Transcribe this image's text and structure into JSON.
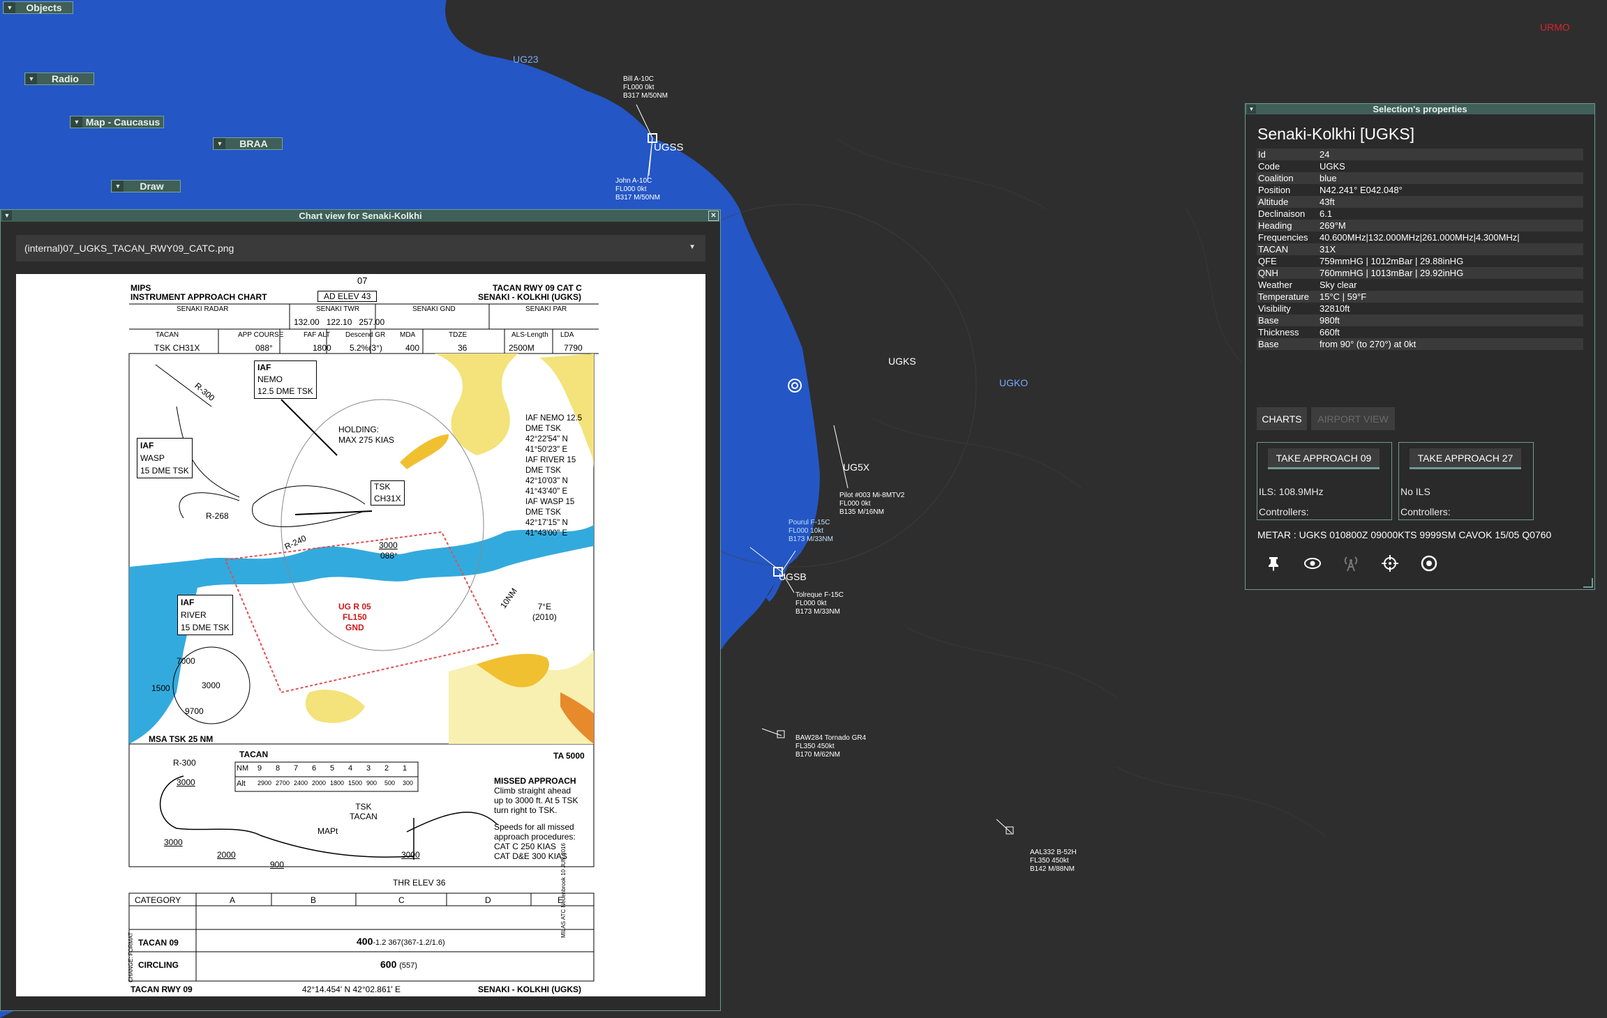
{
  "menus": {
    "objects": "Objects",
    "radio": "Radio",
    "map": "Map - Caucasus",
    "braa": "BRAA",
    "draw": "Draw"
  },
  "map_labels": {
    "ug23": "UG23",
    "urmo": "URMO",
    "ugss": "UGSS",
    "ugks": "UGKS",
    "ugko": "UGKO",
    "ug5x": "UG5X",
    "ugsb": "UGSB"
  },
  "aircraft": [
    {
      "l1": "Bill A-10C",
      "l2": "FL000 0kt",
      "l3": "B317 M/50NM"
    },
    {
      "l1": "John A-10C",
      "l2": "FL000 0kt",
      "l3": "B317 M/50NM"
    },
    {
      "l1": "Pilot #003 Mi-8MTV2",
      "l2": "FL000 0kt",
      "l3": "B135 M/16NM"
    },
    {
      "l1": "Pourul F-15C",
      "l2": "FL000 10kt",
      "l3": "B173 M/33NM"
    },
    {
      "l1": "Tolreque F-15C",
      "l2": "FL000 0kt",
      "l3": "B173 M/33NM"
    },
    {
      "l1": "BAW284 Tornado GR4",
      "l2": "FL350 450kt",
      "l3": "B170 M/62NM"
    },
    {
      "l1": "AAL332 B-52H",
      "l2": "FL350 450kt",
      "l3": "B142 M/88NM"
    }
  ],
  "chart_window": {
    "title": "Chart view for Senaki-Kolkhi",
    "selected_file": "(internal)07_UGKS_TACAN_RWY09_CATC.png"
  },
  "plate": {
    "page_no": "07",
    "org": "MIPS",
    "type": "INSTRUMENT APPROACH CHART",
    "ad_elev": "AD ELEV 43",
    "proc": "TACAN RWY 09 CAT C",
    "airport": "SENAKI - KOLKHI (UGKS)",
    "freq_labels": [
      "SENAKI RADAR",
      "SENAKI TWR",
      "SENAKI GND",
      "SENAKI PAR"
    ],
    "twr_freqs": "132.00   122.10   257.00",
    "data_headers": [
      "TACAN",
      "APP COURSE",
      "FAF ALT",
      "Descend GR",
      "MDA",
      "TDZE",
      "ALS-Length",
      "LDA"
    ],
    "data_values": [
      "TSK CH31X",
      "088°",
      "1800",
      "5.2%(3°)",
      "400",
      "36",
      "2500M",
      "7790"
    ],
    "holding": "HOLDING:",
    "holding2": "MAX 275 KIAS",
    "iaf_nemo": [
      "IAF",
      "NEMO",
      "12.5 DME TSK"
    ],
    "iaf_wasp": [
      "IAF",
      "WASP",
      "15 DME TSK"
    ],
    "iaf_river": [
      "IAF",
      "RIVER",
      "15 DME TSK"
    ],
    "fix_notes": [
      "IAF NEMO 12.5",
      "DME TSK",
      "42°22'54\" N",
      "41°50'23\" E",
      "IAF RIVER 15",
      "DME TSK",
      "42°10'03\" N",
      "41°43'40\" E",
      "IAF WASP 15",
      "DME TSK",
      "42°17'15\" N",
      "41°43'00\" E"
    ],
    "tsk": "TSK",
    "ch31x": "CH31X",
    "restricted": [
      "UG R 05",
      "FL150",
      "GND"
    ],
    "msa": "MSA TSK 25 NM",
    "msa_vals": [
      "7000",
      "1500",
      "3000",
      "9700"
    ],
    "r300": "R-300",
    "r268": "R-268",
    "r240": "R-240",
    "alt_3000": "3000",
    "alt_088": "088°",
    "var": "7°E",
    "var_year": "(2010)",
    "nm10": "10NM",
    "ta": "TA 5000",
    "tacan_hdr": "TACAN",
    "nm_row": [
      "NM",
      "9",
      "8",
      "7",
      "6",
      "5",
      "4",
      "3",
      "2",
      "1"
    ],
    "alt_row": [
      "Alt",
      "2900",
      "2700",
      "2400",
      "2000",
      "1800",
      "1500",
      "900",
      "500",
      "300"
    ],
    "missed_title": "MISSED APPROACH",
    "missed_lines": [
      "Climb straight ahead",
      "up to 3000 ft. At 5 TSK",
      "turn right to TSK."
    ],
    "speed_lines": [
      "Speeds for all missed",
      "approach procedures:",
      "CAT C 250 KIAS",
      "CAT D&E 300 KIAS"
    ],
    "mapt": "MAPt",
    "thr_elev": "THR ELEV 36",
    "profile_alts": [
      "3000",
      "3000",
      "2000",
      "900",
      "3000"
    ],
    "category": "CATEGORY",
    "cats": [
      "A",
      "B",
      "C",
      "D",
      "E"
    ],
    "tacan09": "TACAN 09",
    "tacan09_val": "400",
    "tacan09_sub": "-1.2 367(367-1.2/1.6)",
    "circling": "CIRCLING",
    "circling_val": "600",
    "circling_sub": "(557)",
    "footer_left": "TACAN RWY 09",
    "footer_mid": "42°14.454' N  42°02.861' E",
    "footer_right": "SENAKI - KOLKHI (UGKS)",
    "side_note": "MILAS ATC Neuenbrook 10 JUN 2016",
    "side_left": "CHANGE: FORMAT"
  },
  "selection": {
    "title": "Selection's properties",
    "name": "Senaki-Kolkhi [UGKS]",
    "props": [
      {
        "k": "Id",
        "v": "24"
      },
      {
        "k": "Code",
        "v": "UGKS"
      },
      {
        "k": "Coalition",
        "v": "blue"
      },
      {
        "k": "Position",
        "v": "N42.241° E042.048°"
      },
      {
        "k": "Altitude",
        "v": "43ft"
      },
      {
        "k": "Declinaison",
        "v": "6.1"
      },
      {
        "k": "Heading",
        "v": "269°M"
      },
      {
        "k": "Frequencies",
        "v": "40.600MHz|132.000MHz|261.000MHz|4.300MHz|"
      },
      {
        "k": "TACAN",
        "v": "31X"
      },
      {
        "k": "QFE",
        "v": "759mmHG | 1012mBar | 29.88inHG"
      },
      {
        "k": "QNH",
        "v": "760mmHG | 1013mBar | 29.92inHG"
      },
      {
        "k": "Weather",
        "v": "Sky clear"
      },
      {
        "k": "Temperature",
        "v": "15°C | 59°F"
      },
      {
        "k": "Visibility",
        "v": "32810ft"
      },
      {
        "k": "Base",
        "v": "980ft"
      },
      {
        "k": "Thickness",
        "v": "660ft"
      },
      {
        "k": "Base",
        "v": "from 90° (to 270°) at 0kt"
      }
    ],
    "charts_btn": "CHARTS",
    "airport_view_btn": "AIRPORT VIEW",
    "app09": {
      "btn": "TAKE APPROACH 09",
      "l1": "ILS: 108.9MHz",
      "l2": "Controllers:"
    },
    "app27": {
      "btn": "TAKE APPROACH 27",
      "l1": "No ILS",
      "l2": "Controllers:"
    },
    "metar": "METAR : UGKS 010800Z 09000KTS 9999SM CAVOK 15/05 Q0760",
    "icons": [
      "pin-icon",
      "eye-icon",
      "antenna-icon",
      "crosshair-icon",
      "target-icon"
    ]
  },
  "colors": {
    "sea": "#2456c5",
    "land": "#2e2e2e",
    "panel_title": "#3f5f58",
    "accent": "#6e9c90",
    "urmo": "#d9262b"
  }
}
